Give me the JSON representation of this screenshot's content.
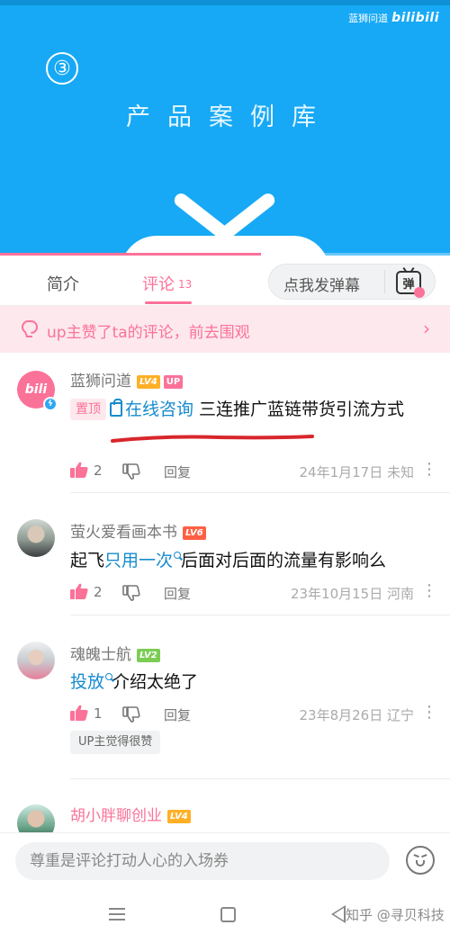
{
  "video": {
    "watermark_text": "蓝狮问道",
    "watermark_logo": "bilibili",
    "number_badge": "③",
    "title": "产品案例库",
    "progress_fraction": 0.58
  },
  "tabs": {
    "intro_label": "简介",
    "comments_label": "评论",
    "comments_count": "13",
    "danmaku_placeholder": "点我发弹幕",
    "danmaku_button": "弹"
  },
  "liked_banner": {
    "text": "up主赞了ta的评论，前去围观",
    "icon": "speech-bubble-icon"
  },
  "comments": [
    {
      "username": "蓝狮问道",
      "level": "LV4",
      "up_tag": "UP",
      "avatar_text": "bili",
      "pinned_label": "置顶",
      "link_text": "在线咨询",
      "text": " 三连推广蓝链带货引流方式",
      "likes": "2",
      "reply_label": "回复",
      "meta": "24年1月17日 未知"
    },
    {
      "username": "萤火爱看画本书",
      "level": "LV6",
      "text_before": "起飞",
      "link_text": "只用一次",
      "text_after": "后面对后面的流量有影响么",
      "likes": "2",
      "reply_label": "回复",
      "meta": "23年10月15日 河南"
    },
    {
      "username": "魂魄士航",
      "level": "LV2",
      "link_text": "投放",
      "text_after": "介绍太绝了",
      "likes": "1",
      "reply_label": "回复",
      "meta": "23年8月26日 辽宁",
      "up_liked_chip": "UP主觉得很赞"
    },
    {
      "username": "胡小胖聊创业",
      "level": "LV4"
    }
  ],
  "input": {
    "placeholder": "尊重是评论打动人心的入场券"
  },
  "footer": {
    "watermark": "知乎 @寻贝科技"
  },
  "colors": {
    "banner_blue": "#17a9f5",
    "bili_pink": "#fb7299",
    "link_blue": "#178bcf",
    "annotation_red": "#d8262b"
  }
}
